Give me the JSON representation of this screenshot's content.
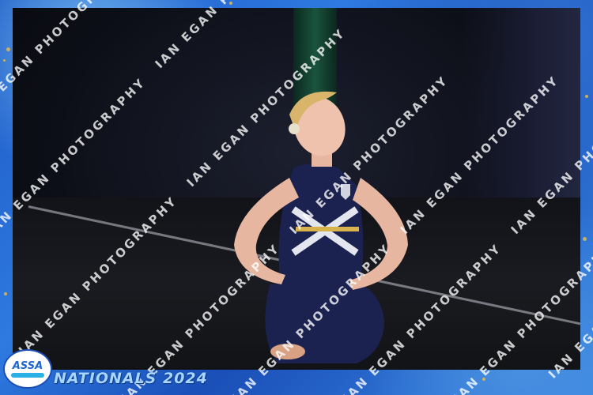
{
  "event": {
    "title": "NATIONALS 2024",
    "logo_text": "ASSA"
  },
  "watermark": {
    "text": "IAN EGAN PHOTOGRAPHY"
  },
  "colors": {
    "frame_blue": "#1d58c4",
    "gold_fleck": "#e6b94a",
    "costume_navy": "#1c2250",
    "title_color": "#a9d6ff"
  }
}
